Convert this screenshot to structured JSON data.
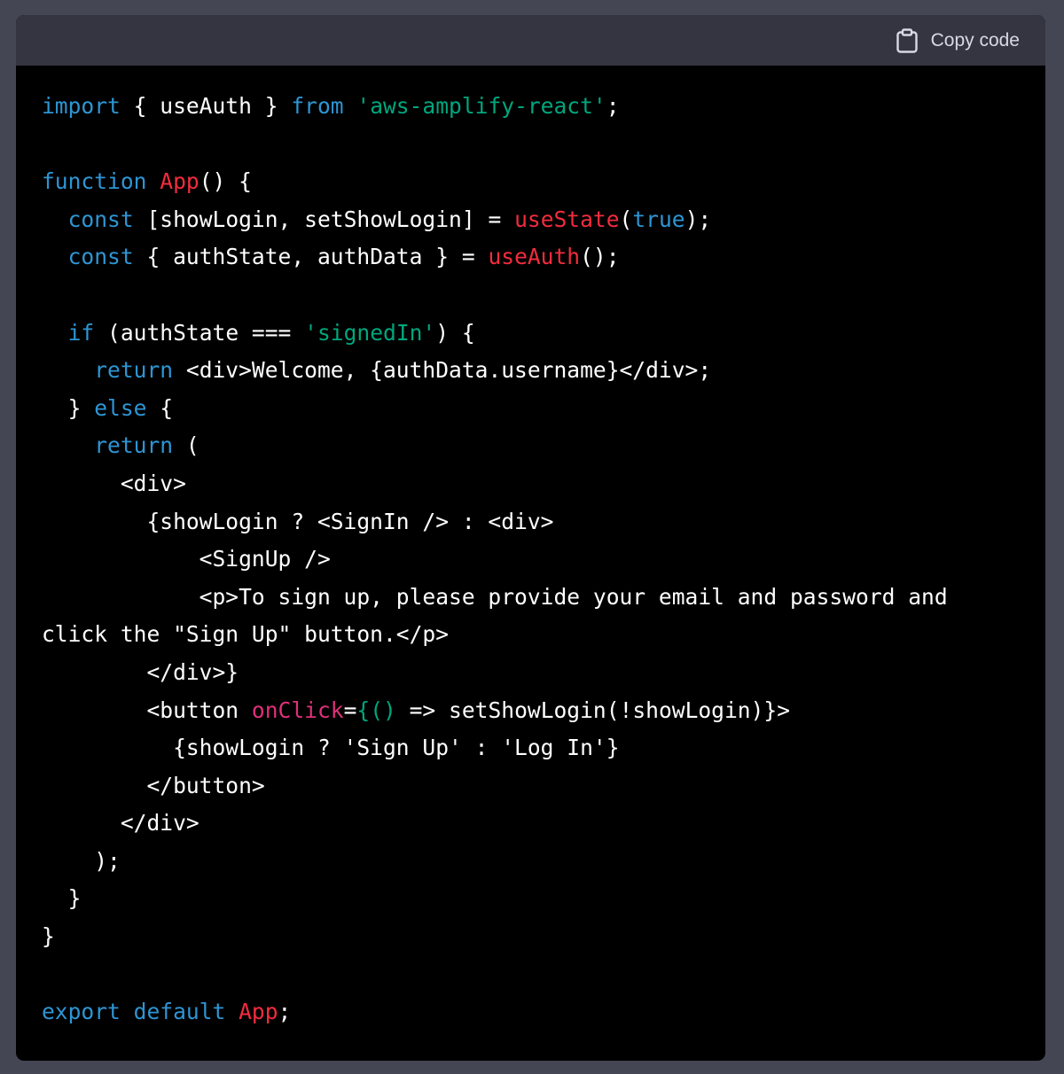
{
  "header": {
    "copy_label": "Copy code",
    "copy_icon": "clipboard-icon"
  },
  "colors": {
    "page_background": "#444654",
    "header_background": "#343541",
    "code_background": "#000000",
    "keyword": "#2e95d3",
    "function": "#f22c3d",
    "string": "#00a67d",
    "attribute": "#df3079",
    "plain": "#ffffff"
  },
  "code": {
    "lines": [
      [
        [
          "kw",
          "import"
        ],
        [
          "pl",
          " { useAuth } "
        ],
        [
          "kw",
          "from"
        ],
        [
          "pl",
          " "
        ],
        [
          "str",
          "'aws-amplify-react'"
        ],
        [
          "pl",
          ";"
        ]
      ],
      [],
      [
        [
          "kw",
          "function"
        ],
        [
          "pl",
          " "
        ],
        [
          "fn",
          "App"
        ],
        [
          "pl",
          "() {"
        ]
      ],
      [
        [
          "pl",
          "  "
        ],
        [
          "kw",
          "const"
        ],
        [
          "pl",
          " [showLogin, setShowLogin] = "
        ],
        [
          "fn",
          "useState"
        ],
        [
          "pl",
          "("
        ],
        [
          "kw",
          "true"
        ],
        [
          "pl",
          ");"
        ]
      ],
      [
        [
          "pl",
          "  "
        ],
        [
          "kw",
          "const"
        ],
        [
          "pl",
          " { authState, authData } = "
        ],
        [
          "fn",
          "useAuth"
        ],
        [
          "pl",
          "();"
        ]
      ],
      [],
      [
        [
          "pl",
          "  "
        ],
        [
          "kw",
          "if"
        ],
        [
          "pl",
          " (authState === "
        ],
        [
          "str",
          "'signedIn'"
        ],
        [
          "pl",
          ") {"
        ]
      ],
      [
        [
          "pl",
          "    "
        ],
        [
          "kw",
          "return"
        ],
        [
          "pl",
          " <div>Welcome, {authData.username}</div>;"
        ]
      ],
      [
        [
          "pl",
          "  } "
        ],
        [
          "kw",
          "else"
        ],
        [
          "pl",
          " {"
        ]
      ],
      [
        [
          "pl",
          "    "
        ],
        [
          "kw",
          "return"
        ],
        [
          "pl",
          " ("
        ]
      ],
      [
        [
          "pl",
          "      <div>"
        ]
      ],
      [
        [
          "pl",
          "        {showLogin ? <SignIn /> : <div>"
        ]
      ],
      [
        [
          "pl",
          "            <SignUp />"
        ]
      ],
      [
        [
          "pl",
          "            <p>To sign up, please provide your email and password and"
        ]
      ],
      [
        [
          "pl",
          "click the \"Sign Up\" button.</p>"
        ]
      ],
      [
        [
          "pl",
          "        </div>}"
        ]
      ],
      [
        [
          "pl",
          "        <button "
        ],
        [
          "attr",
          "onClick"
        ],
        [
          "pl",
          "="
        ],
        [
          "str",
          "{() "
        ],
        [
          "pl",
          "=> setShowLogin(!showLogin)}>"
        ]
      ],
      [
        [
          "pl",
          "          {showLogin ? 'Sign Up' : 'Log In'}"
        ]
      ],
      [
        [
          "pl",
          "        </button>"
        ]
      ],
      [
        [
          "pl",
          "      </div>"
        ]
      ],
      [
        [
          "pl",
          "    );"
        ]
      ],
      [
        [
          "pl",
          "  }"
        ]
      ],
      [
        [
          "pl",
          "}"
        ]
      ],
      [],
      [
        [
          "kw",
          "export"
        ],
        [
          "pl",
          " "
        ],
        [
          "kw",
          "default"
        ],
        [
          "pl",
          " "
        ],
        [
          "fn",
          "App"
        ],
        [
          "pl",
          ";"
        ]
      ]
    ]
  }
}
